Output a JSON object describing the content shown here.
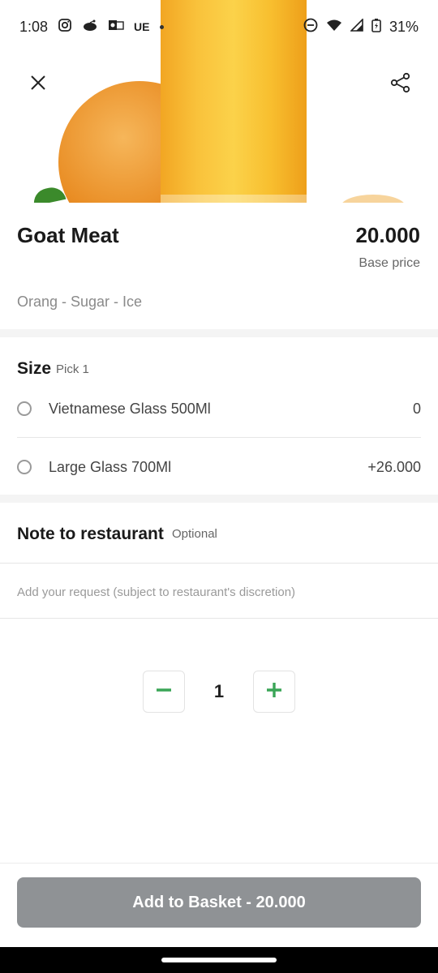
{
  "status_bar": {
    "time": "1:08",
    "carrier": "UE",
    "battery": "31%",
    "icons": [
      "instagram-icon",
      "reddit-icon",
      "outlook-icon",
      "dnd-icon",
      "wifi-icon",
      "signal-icon",
      "battery-icon"
    ]
  },
  "hero": {
    "icons": [
      "close-icon",
      "share-icon"
    ]
  },
  "product": {
    "name": "Goat Meat",
    "price": "20.000",
    "price_caption": "Base price",
    "description": "Orang - Sugar - Ice"
  },
  "size": {
    "title": "Size",
    "pick": "Pick 1",
    "options": [
      {
        "label": "Vietnamese Glass 500Ml",
        "price": "0"
      },
      {
        "label": "Large Glass 700Ml",
        "price": "+26.000"
      }
    ]
  },
  "note": {
    "title": "Note to restaurant",
    "optional": "Optional",
    "placeholder": "Add your request (subject to restaurant's discretion)"
  },
  "quantity": {
    "value": "1"
  },
  "footer": {
    "add_label": "Add to Basket - 20.000"
  },
  "colors": {
    "accent_green": "#3aa557",
    "button_disabled": "#8f9295"
  }
}
